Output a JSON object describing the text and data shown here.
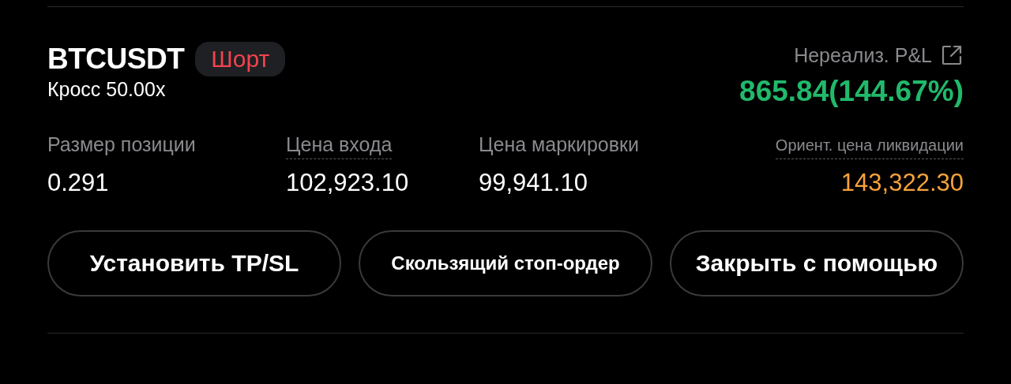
{
  "position": {
    "symbol": "BTCUSDT",
    "side_badge": "Шорт",
    "margin_mode": "Кросс 50.00x"
  },
  "pnl": {
    "label": "Нереализ. P&L",
    "value": "865.84(144.67%)"
  },
  "stats": [
    {
      "label": "Размер позиции",
      "value": "0.291",
      "underlined": false,
      "small_label": false,
      "color": "#ffffff"
    },
    {
      "label": "Цена входа",
      "value": "102,923.10",
      "underlined": true,
      "small_label": false,
      "color": "#ffffff"
    },
    {
      "label": "Цена маркировки",
      "value": "99,941.10",
      "underlined": false,
      "small_label": false,
      "color": "#ffffff"
    },
    {
      "label": "Ориент. цена ликвидации",
      "value": "143,322.30",
      "underlined": true,
      "small_label": true,
      "color": "#f7a23b"
    }
  ],
  "buttons": [
    {
      "label": "Установить TP/SL",
      "small": false
    },
    {
      "label": "Скользящий стоп-ордер",
      "small": true
    },
    {
      "label": "Закрыть с помощью",
      "small": false
    }
  ]
}
